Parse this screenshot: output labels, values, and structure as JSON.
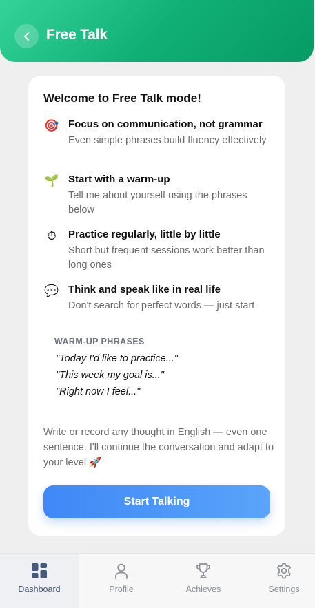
{
  "header": {
    "title": "Free Talk"
  },
  "card": {
    "title": "Welcome to Free Talk mode!",
    "tips": [
      {
        "icon": "target-icon",
        "glyph": "🎯",
        "title": "Focus on communication, not grammar",
        "description": "Even simple phrases build fluency effectively"
      },
      {
        "icon": "seedling-icon",
        "glyph": "🌱",
        "title": "Start with a warm-up",
        "description": "Tell me about yourself using the phrases below"
      },
      {
        "icon": "stopwatch-icon",
        "glyph": "⏱",
        "title": "Practice regularly, little by little",
        "description": "Short but frequent sessions work better than long ones"
      },
      {
        "icon": "speech-bubble-icon",
        "glyph": "💬",
        "title": "Think and speak like in real life",
        "description": "Don't search for perfect words — just start"
      }
    ],
    "warmup_label": "WARM-UP PHRASES",
    "phrases": [
      "\"Today I'd like to practice...\"",
      "\"This week my goal is...\"",
      "\"Right now I feel...\""
    ],
    "outro": "Write or record any thought in English — even one sentence. I'll continue the conversation and adapt to your level 🚀",
    "start_button": "Start Talking"
  },
  "nav": {
    "items": [
      {
        "label": "Dashboard",
        "icon": "dashboard-icon",
        "active": true
      },
      {
        "label": "Profile",
        "icon": "profile-icon",
        "active": false
      },
      {
        "label": "Achieves",
        "icon": "trophy-icon",
        "active": false
      },
      {
        "label": "Settings",
        "icon": "gear-icon",
        "active": false
      }
    ]
  },
  "colors": {
    "header_start": "#34d39a",
    "header_end": "#079a64",
    "button_start": "#3f88f7",
    "button_end": "#5aa4fa",
    "nav_active": "#46597a",
    "nav_inactive": "#8a8f97"
  }
}
